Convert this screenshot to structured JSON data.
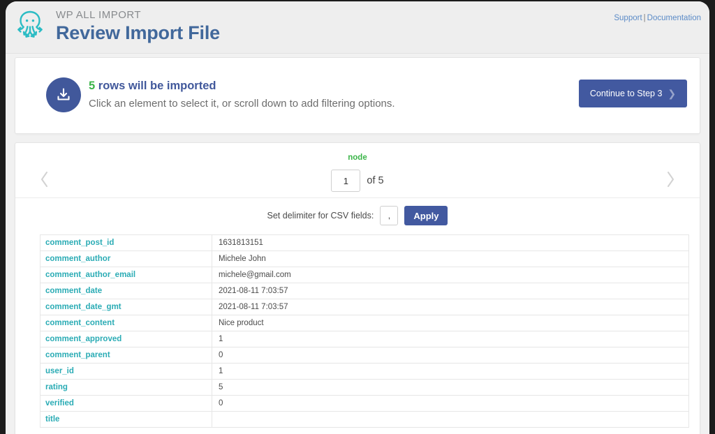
{
  "header": {
    "brand_sub": "WP ALL IMPORT",
    "brand_title": "Review Import File",
    "logo_icon": "octopus-logo-icon",
    "links": {
      "support": "Support",
      "separator": "|",
      "documentation": "Documentation"
    }
  },
  "info": {
    "icon": "download-icon",
    "count": "5",
    "headline_rest": " rows will be imported",
    "subtext": "Click an element to select it, or scroll down to add filtering options.",
    "continue_label": "Continue to Step 3",
    "continue_chevron": "chevron-right-icon",
    "accent_blue": "#41589b",
    "accent_green": "#3cb54a"
  },
  "pager": {
    "node_label": "node",
    "page_value": "1",
    "page_total": "of 5",
    "prev_icon": "chevron-left-icon",
    "next_icon": "chevron-right-icon"
  },
  "delimiter": {
    "label": "Set delimiter for CSV fields:",
    "value": ",",
    "apply_label": "Apply"
  },
  "table": {
    "rows": [
      {
        "field": "comment_post_id",
        "value": "1631813151"
      },
      {
        "field": "comment_author",
        "value": "Michele John"
      },
      {
        "field": "comment_author_email",
        "value": "michele@gmail.com"
      },
      {
        "field": "comment_date",
        "value": "2021-08-11 7:03:57"
      },
      {
        "field": "comment_date_gmt",
        "value": "2021-08-11 7:03:57"
      },
      {
        "field": "comment_content",
        "value": "Nice product"
      },
      {
        "field": "comment_approved",
        "value": "1"
      },
      {
        "field": "comment_parent",
        "value": "0"
      },
      {
        "field": "user_id",
        "value": "1"
      },
      {
        "field": "rating",
        "value": "5"
      },
      {
        "field": "verified",
        "value": "0"
      },
      {
        "field": "title",
        "value": ""
      }
    ],
    "field_color": "#2bacb5"
  }
}
